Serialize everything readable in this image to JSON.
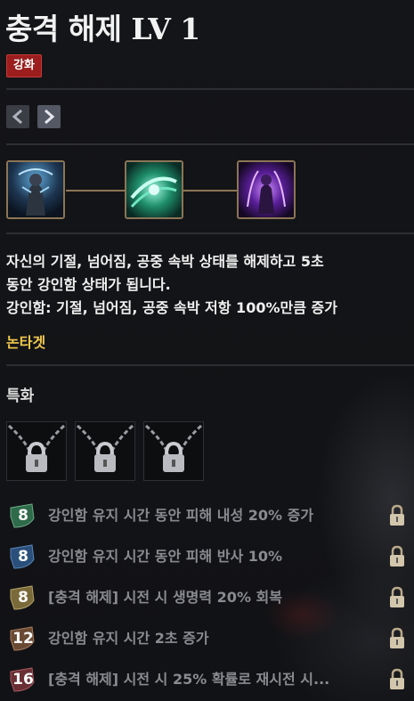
{
  "skill": {
    "title": "충격 해제 LV 1",
    "badge": "강화"
  },
  "icons": {
    "prev": "chevron-left-icon",
    "next": "chevron-right-icon",
    "lock": "lock-icon"
  },
  "tripod_icons": [
    "armored-warrior-skill-icon",
    "green-swirl-skill-icon",
    "purple-aura-skill-icon"
  ],
  "description": {
    "line1": "자신의 기절, 넘어짐, 공중 속박 상태를 해제하고 5초",
    "line2": "동안 강인함 상태가 됩니다.",
    "line3": "강인함: 기절, 넘어짐, 공중 속박 저항 100%만큼 증가",
    "target": "논타겟"
  },
  "specialization": {
    "title": "특화",
    "slots": 3
  },
  "tripods": [
    {
      "level": "8",
      "text": "강인함 유지 시간 동안 피해 내성 20% 증가",
      "color": "#2f6b4a"
    },
    {
      "level": "8",
      "text": "강인함 유지 시간 동안 피해 반사 10%",
      "color": "#2a4f7a"
    },
    {
      "level": "8",
      "text": "[충격 해제] 시전 시 생명력 20% 회복",
      "color": "#7a6a3a"
    },
    {
      "level": "12",
      "text": "강인함 유지 시간 2초 증가",
      "color": "#6a4a34"
    },
    {
      "level": "16",
      "text": "[충격 해제] 시전 시 25% 확률로 재시전 시...",
      "color": "#6a2f34"
    }
  ],
  "colors": {
    "badge": "#9b1d1d",
    "target": "#f2c94c",
    "frame": "#8c7555"
  }
}
